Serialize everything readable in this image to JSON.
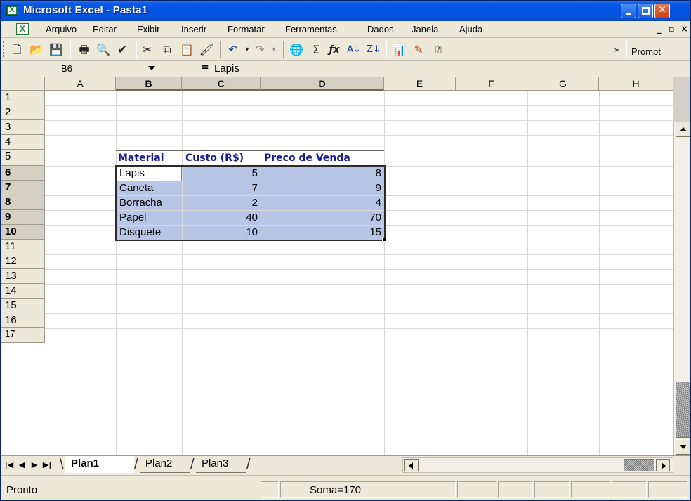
{
  "window": {
    "title": "Microsoft Excel - Pasta1"
  },
  "menu": {
    "items": [
      "Arquivo",
      "Editar",
      "Exibir",
      "Inserir",
      "Formatar",
      "Ferramentas",
      "Dados",
      "Janela",
      "Ajuda"
    ],
    "mdi_min": "_",
    "mdi_restore": "ð",
    "mdi_close": "×"
  },
  "toolbar": {
    "icons": [
      "new-icon",
      "open-icon",
      "save-icon",
      "print-icon",
      "print-preview-icon",
      "spelling-icon",
      "cut-icon",
      "copy-icon",
      "paste-icon",
      "format-painter-icon",
      "undo-icon",
      "redo-icon",
      "web-icon",
      "autosum-icon",
      "function-icon",
      "sort-ascending-icon",
      "sort-descending-icon",
      "chart-wizard-icon",
      "drawing-icon",
      "help-icon",
      "more-icon"
    ],
    "prompt_label": "Prompt"
  },
  "formula_bar": {
    "name_box": "B6",
    "equals": "=",
    "value": "Lapis"
  },
  "grid": {
    "columns": [
      "A",
      "B",
      "C",
      "D",
      "E",
      "F",
      "G",
      "H"
    ],
    "rows": [
      "1",
      "2",
      "3",
      "4",
      "5",
      "6",
      "7",
      "8",
      "9",
      "10",
      "11",
      "12",
      "13",
      "14",
      "15",
      "16",
      "17"
    ],
    "selected_columns": [
      "B",
      "C",
      "D"
    ],
    "selected_rows": [
      "6",
      "7",
      "8",
      "9",
      "10"
    ],
    "table": {
      "headers": [
        "Material",
        "Custo (R$)",
        "Preco de Venda"
      ],
      "rows": [
        [
          "Lapis",
          "5",
          "8"
        ],
        [
          "Caneta",
          "7",
          "9"
        ],
        [
          "Borracha",
          "2",
          "4"
        ],
        [
          "Papel",
          "40",
          "70"
        ],
        [
          "Disquete",
          "10",
          "15"
        ]
      ]
    },
    "selection_color": "#b7c6e6",
    "header_text_color": "#1a1a8c"
  },
  "sheets": {
    "tabs": [
      "Plan1",
      "Plan2",
      "Plan3"
    ],
    "active": "Plan1"
  },
  "status": {
    "text": "Pronto",
    "sum": "Soma=170"
  }
}
